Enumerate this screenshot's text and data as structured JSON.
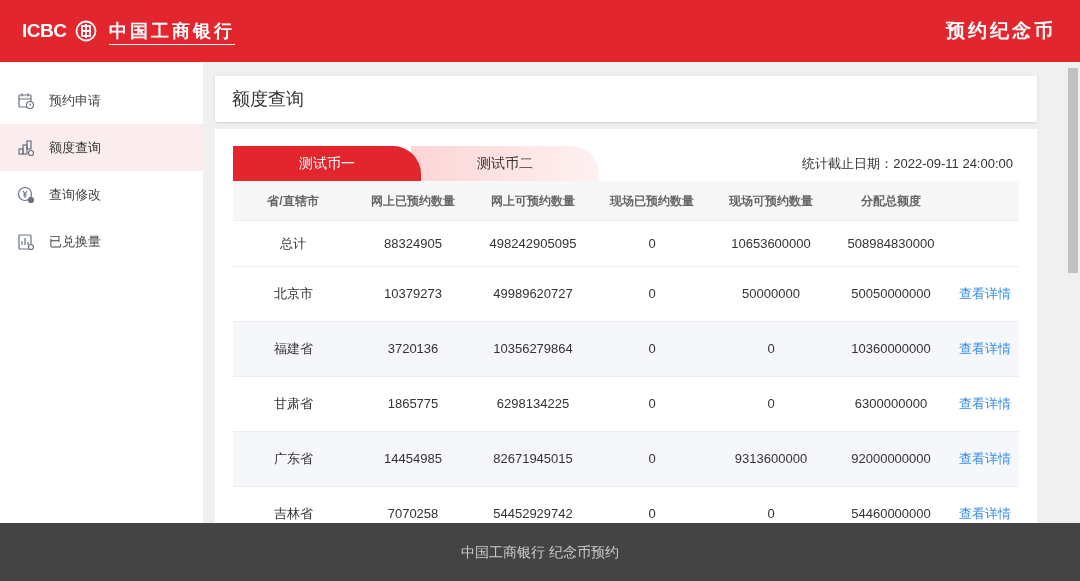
{
  "header": {
    "brand_en": "ICBC",
    "brand_cn": "中国工商银行",
    "title": "预约纪念币"
  },
  "sidebar": {
    "items": [
      {
        "label": "预约申请",
        "selected": false
      },
      {
        "label": "额度查询",
        "selected": true
      },
      {
        "label": "查询修改",
        "selected": false
      },
      {
        "label": "已兑换量",
        "selected": false
      }
    ]
  },
  "page_title": "额度查询",
  "tabs": [
    {
      "label": "测试币一",
      "selected": true
    },
    {
      "label": "测试币二",
      "selected": false
    }
  ],
  "stat_date": "统计截止日期：2022-09-11 24:00:00",
  "table": {
    "columns": [
      "省/直辖市",
      "网上已预约数量",
      "网上可预约数量",
      "现场已预约数量",
      "现场可预约数量",
      "分配总额度"
    ],
    "rows": [
      {
        "cells": [
          "总计",
          "88324905",
          "498242905095",
          "0",
          "10653600000",
          "508984830000"
        ]
      },
      {
        "cells": [
          "北京市",
          "10379273",
          "49989620727",
          "0",
          "50000000",
          "50050000000"
        ],
        "link": "查看详情"
      },
      {
        "cells": [
          "福建省",
          "3720136",
          "10356279864",
          "0",
          "0",
          "10360000000"
        ],
        "link": "查看详情"
      },
      {
        "cells": [
          "甘肃省",
          "1865775",
          "6298134225",
          "0",
          "0",
          "6300000000"
        ],
        "link": "查看详情"
      },
      {
        "cells": [
          "广东省",
          "14454985",
          "82671945015",
          "0",
          "9313600000",
          "92000000000"
        ],
        "link": "查看详情"
      },
      {
        "cells": [
          "吉林省",
          "7070258",
          "54452929742",
          "0",
          "0",
          "54460000000"
        ],
        "link": "查看详情"
      }
    ]
  },
  "footer": "中国工商银行 纪念币预约"
}
